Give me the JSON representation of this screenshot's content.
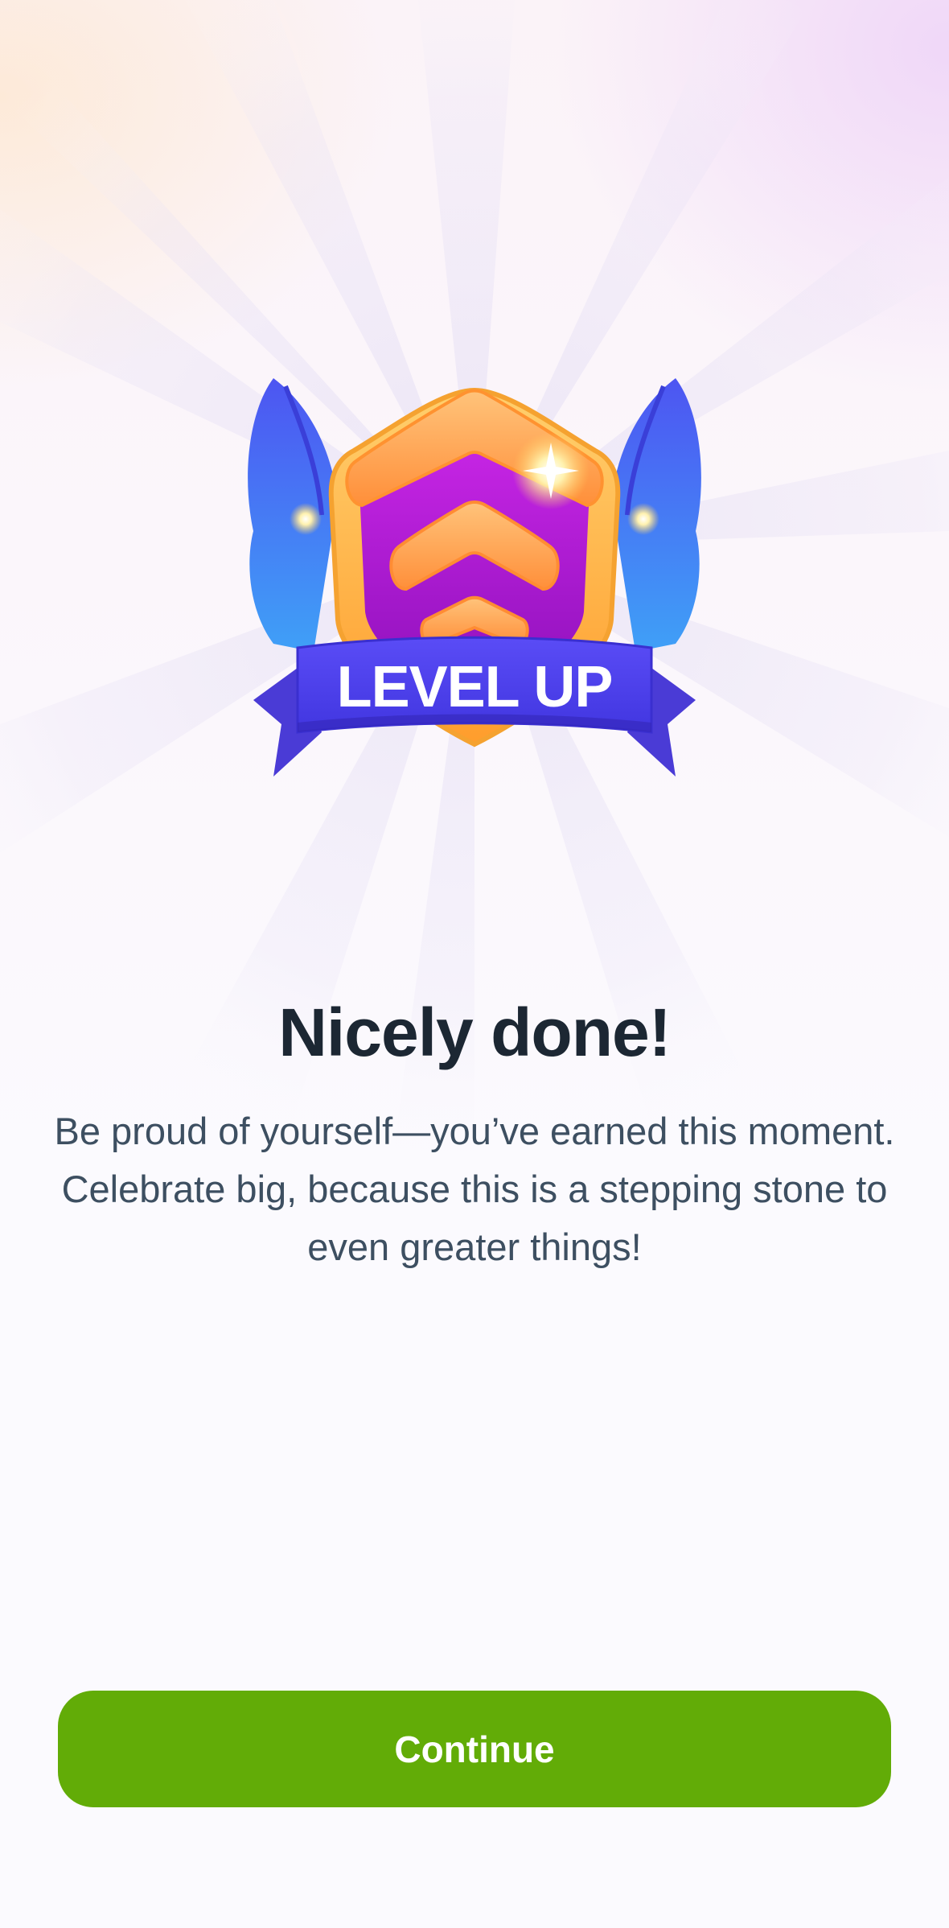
{
  "badge": {
    "ribbon_text": "LEVEL UP",
    "icon": "level-up-badge-icon"
  },
  "headline": "Nicely done!",
  "body_lines": [
    "Be proud of yourself—you’ve earned this moment.",
    "Celebrate big, because this is a stepping stone to",
    "even greater things!"
  ],
  "continue_label": "Continue",
  "colors": {
    "primary_button": "#62ac07",
    "headline": "#1c2733",
    "body": "#3d4f61",
    "ribbon": "#5545f0",
    "shield_gold": "#ffb443",
    "shield_purple": "#b21fd8",
    "wings_blue": "#4f6cf5"
  }
}
